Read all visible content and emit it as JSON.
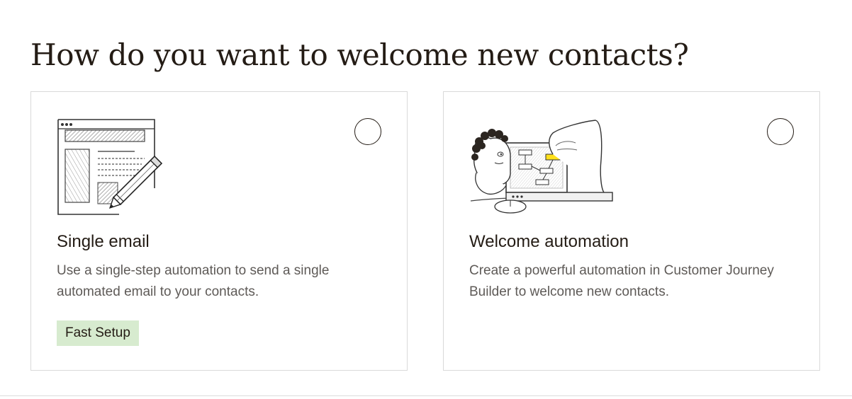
{
  "page": {
    "title": "How do you want to welcome new contacts?"
  },
  "options": [
    {
      "title": "Single email",
      "description": "Use a single-step automation to send a single automated email to your contacts.",
      "badge": "Fast Setup",
      "illustration": "email-editor-pencil-illustration",
      "selected": false
    },
    {
      "title": "Welcome automation",
      "description": "Create a powerful automation in Customer Journey Builder to welcome new contacts.",
      "illustration": "person-building-journey-illustration",
      "selected": false
    }
  ],
  "colors": {
    "text": "#241c15",
    "muted_text": "#5e5a57",
    "badge_bg": "#d7ebcf",
    "card_border": "#d9d9d9",
    "highlight": "#ffe01b"
  }
}
